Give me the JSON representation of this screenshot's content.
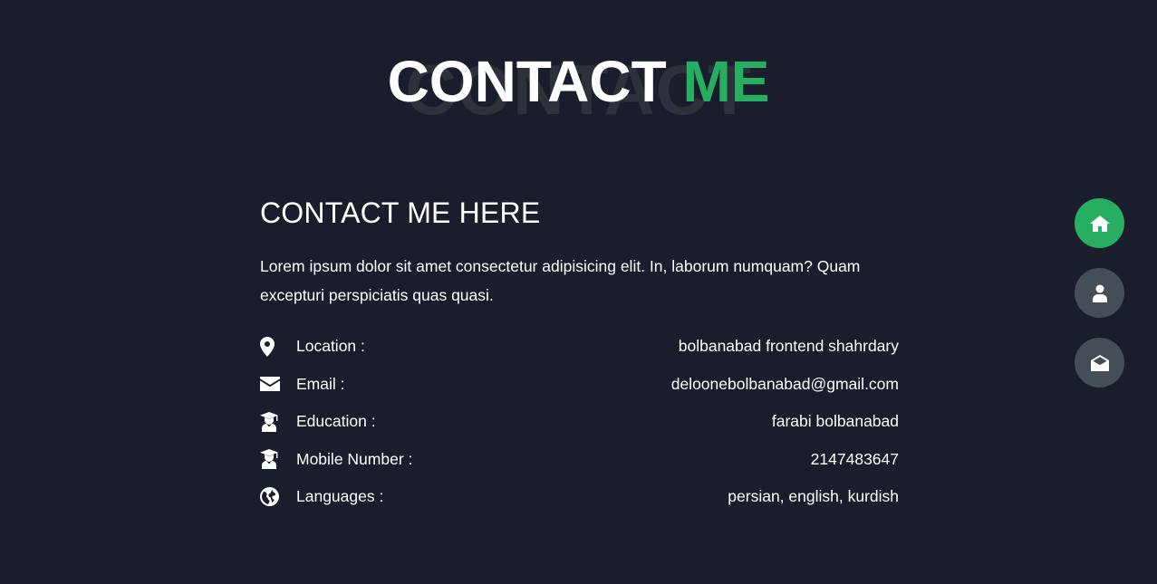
{
  "heading": {
    "background_word": "CONTACT",
    "title_main": "CONTACT",
    "title_accent": "ME"
  },
  "contact": {
    "subtitle": "CONTACT ME HERE",
    "description": "Lorem ipsum dolor sit amet consectetur adipisicing elit. In, laborum numquam? Quam excepturi perspiciatis quas quasi.",
    "items": [
      {
        "icon": "map-marker-icon",
        "label": "Location :",
        "value": "bolbanabad frontend shahrdary"
      },
      {
        "icon": "envelope-icon",
        "label": "Email :",
        "value": "deloonebolbanabad@gmail.com"
      },
      {
        "icon": "graduate-icon",
        "label": "Education :",
        "value": "farabi bolbanabad"
      },
      {
        "icon": "graduate-icon",
        "label": "Mobile Number :",
        "value": "2147483647"
      },
      {
        "icon": "globe-icon",
        "label": "Languages :",
        "value": "persian, english, kurdish"
      }
    ]
  },
  "side_nav": {
    "items": [
      {
        "icon": "home-icon",
        "active": true
      },
      {
        "icon": "user-icon",
        "active": false
      },
      {
        "icon": "envelope-open-icon",
        "active": false
      }
    ]
  },
  "colors": {
    "background": "#1a1d2b",
    "accent": "#27ae60",
    "nav_button": "#454e56",
    "heading_shadow_text": "#2d313a"
  }
}
